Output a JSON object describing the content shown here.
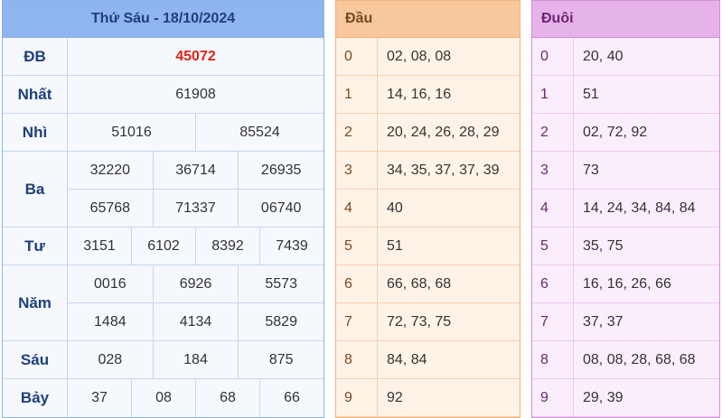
{
  "results": {
    "title": "Thứ Sáu - 18/10/2024",
    "prizes": [
      {
        "label": "ĐB",
        "lines": [
          [
            "45072"
          ]
        ],
        "special": true
      },
      {
        "label": "Nhất",
        "lines": [
          [
            "61908"
          ]
        ]
      },
      {
        "label": "Nhì",
        "lines": [
          [
            "51016",
            "85524"
          ]
        ]
      },
      {
        "label": "Ba",
        "lines": [
          [
            "32220",
            "36714",
            "26935"
          ],
          [
            "65768",
            "71337",
            "06740"
          ]
        ]
      },
      {
        "label": "Tư",
        "lines": [
          [
            "3151",
            "6102",
            "8392",
            "7439"
          ]
        ]
      },
      {
        "label": "Năm",
        "lines": [
          [
            "0016",
            "6926",
            "5573"
          ],
          [
            "1484",
            "4134",
            "5829"
          ]
        ]
      },
      {
        "label": "Sáu",
        "lines": [
          [
            "028",
            "184",
            "875"
          ]
        ]
      },
      {
        "label": "Bảy",
        "lines": [
          [
            "37",
            "08",
            "68",
            "66"
          ]
        ]
      }
    ]
  },
  "dau": {
    "title": "Đầu",
    "rows": [
      {
        "digit": "0",
        "values": "02, 08, 08"
      },
      {
        "digit": "1",
        "values": "14, 16, 16"
      },
      {
        "digit": "2",
        "values": "20, 24, 26, 28, 29"
      },
      {
        "digit": "3",
        "values": "34, 35, 37, 37, 39"
      },
      {
        "digit": "4",
        "values": "40"
      },
      {
        "digit": "5",
        "values": "51"
      },
      {
        "digit": "6",
        "values": "66, 68, 68"
      },
      {
        "digit": "7",
        "values": "72, 73, 75"
      },
      {
        "digit": "8",
        "values": "84, 84"
      },
      {
        "digit": "9",
        "values": "92"
      }
    ]
  },
  "duoi": {
    "title": "Đuôi",
    "rows": [
      {
        "digit": "0",
        "values": "20, 40"
      },
      {
        "digit": "1",
        "values": "51"
      },
      {
        "digit": "2",
        "values": "02, 72, 92"
      },
      {
        "digit": "3",
        "values": "73"
      },
      {
        "digit": "4",
        "values": "14, 24, 34, 84, 84"
      },
      {
        "digit": "5",
        "values": "35, 75"
      },
      {
        "digit": "6",
        "values": "16, 16, 26, 66"
      },
      {
        "digit": "7",
        "values": "37, 37"
      },
      {
        "digit": "8",
        "values": "08, 08, 28, 68, 68"
      },
      {
        "digit": "9",
        "values": "29, 39"
      }
    ]
  }
}
